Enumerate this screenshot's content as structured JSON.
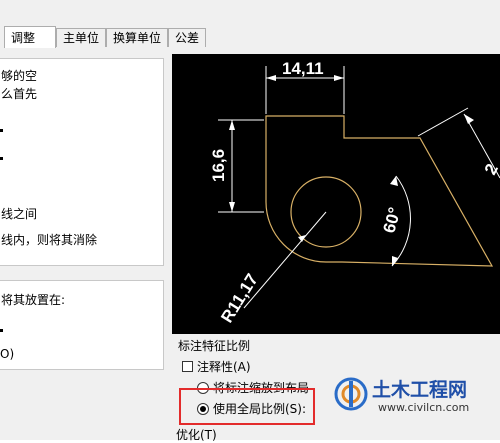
{
  "tabs": [
    {
      "label": "调整",
      "active": true
    },
    {
      "label": "主单位",
      "active": false
    },
    {
      "label": "换算单位",
      "active": false
    },
    {
      "label": "公差",
      "active": false
    }
  ],
  "left_group": {
    "line1": "够的空",
    "line2": "么首先",
    "line3": "线之间",
    "line4": "线内，则将其消除"
  },
  "placement_group": {
    "line1": "将其放置在:",
    "line2": "O)"
  },
  "preview": {
    "dim_horizontal": "14,11",
    "dim_vertical": "16,6",
    "dim_radius": "R11,17",
    "dim_angle": "60°",
    "dim_partial": "2"
  },
  "scale_section": {
    "title": "标注特征比例",
    "annotative_label": "注释性(A)",
    "annotative_checked": false,
    "radio_layout_label": "将标注缩放到布局",
    "radio_global_label": "使用全局比例(S):",
    "selected": "global"
  },
  "optimize_section": {
    "title": "优化(T)"
  },
  "watermark": {
    "title": "土木工程网",
    "url": "www.civilcn.com"
  },
  "colors": {
    "dimension_line": "#ffffff",
    "geometry": "#d8b066",
    "highlight_box": "#e32b2b",
    "watermark_blue": "#1f4fa8"
  }
}
